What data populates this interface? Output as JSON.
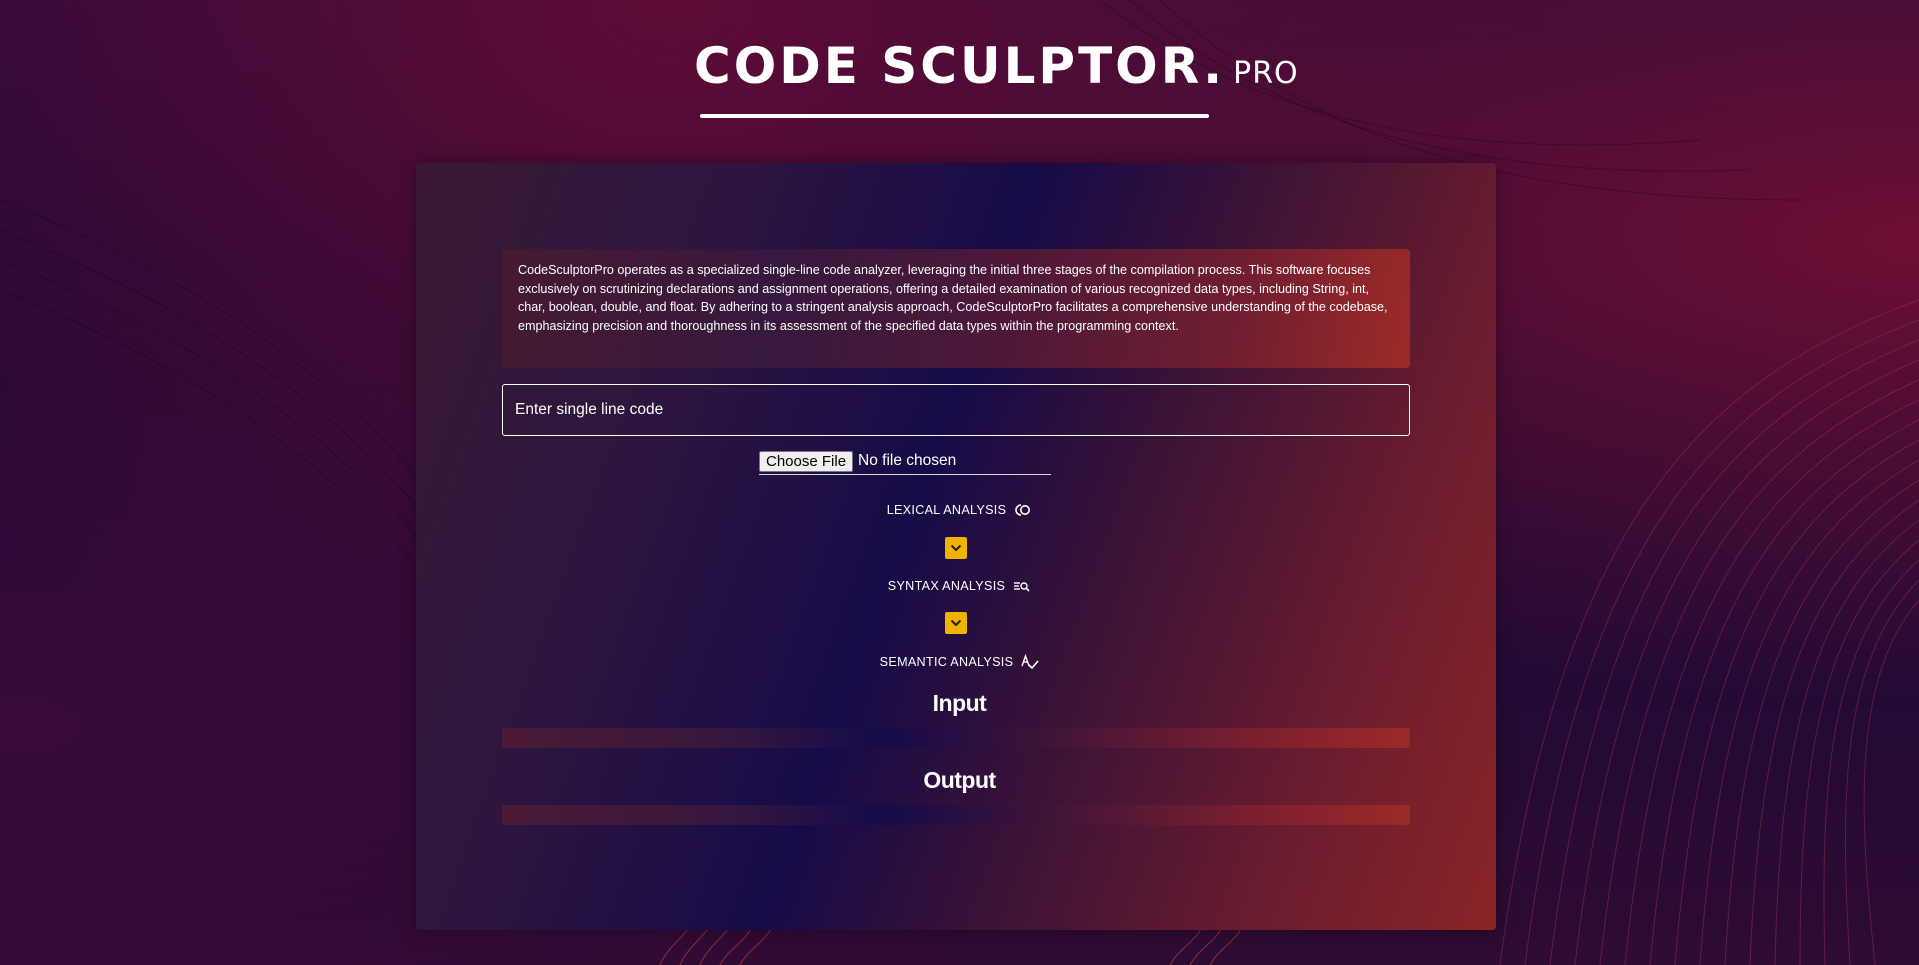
{
  "header": {
    "logo_main": "CODE SCULPTOR.",
    "logo_suffix": "PRO"
  },
  "description": "CodeSculptorPro operates as a specialized single-line code analyzer, leveraging the initial three stages of the compilation process. This software focuses exclusively on scrutinizing declarations and assignment operations, offering a detailed examination of various recognized data types, including String, int, char, boolean, double, and float. By adhering to a stringent analysis approach, CodeSculptorPro facilitates a comprehensive understanding of the codebase, emphasizing precision and thoroughness in its assessment of the specified data types within the programming context.",
  "code_input": {
    "placeholder": "Enter single line code",
    "value": ""
  },
  "file_input": {
    "button_label": "Choose File",
    "status": "No file chosen"
  },
  "stages": {
    "lexical": {
      "label": "LEXICAL ANALYSIS",
      "icon": "lexical-analysis-icon"
    },
    "syntax": {
      "label": "SYNTAX ANALYSIS",
      "icon": "syntax-search-icon"
    },
    "semantic": {
      "label": "SEMANTIC ANALYSIS",
      "icon": "spellcheck-icon"
    }
  },
  "sections": {
    "input_heading": "Input",
    "output_heading": "Output"
  },
  "colors": {
    "accent": "#f0b400",
    "text": "#ffffff"
  }
}
